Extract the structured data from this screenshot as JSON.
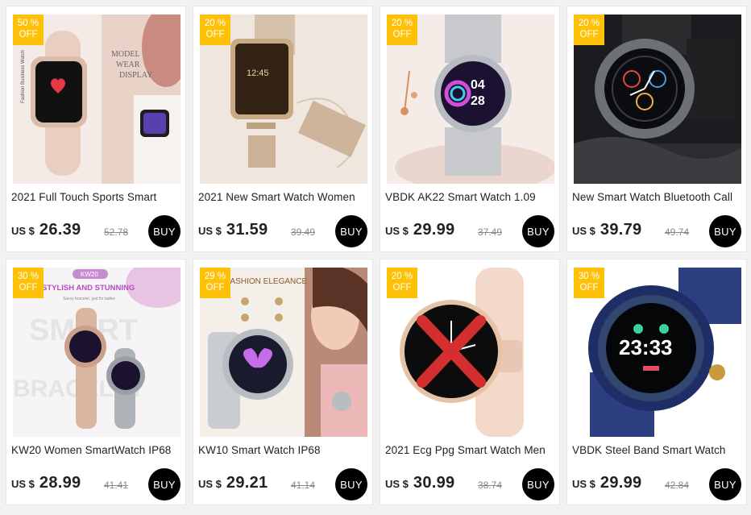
{
  "products": [
    {
      "badge_pct": "50 %",
      "badge_off": "OFF",
      "image_text_1": "MODEL",
      "image_text_2": "WEAR",
      "image_text_3": "DISPLAY",
      "image_text_4": "Fashion Business Watch",
      "title": "2021 Full Touch Sports Smart",
      "currency": "US $",
      "price": "26.39",
      "old_price": "52.78",
      "buy_label": "BUY"
    },
    {
      "badge_pct": "20 %",
      "badge_off": "OFF",
      "watch_time": "12:45",
      "title": "2021 New Smart Watch Women",
      "currency": "US $",
      "price": "31.59",
      "old_price": "39.49",
      "buy_label": "BUY"
    },
    {
      "badge_pct": "20 %",
      "badge_off": "OFF",
      "watch_time_h": "04",
      "watch_time_m": "28",
      "title": "VBDK AK22 Smart Watch 1.09",
      "currency": "US $",
      "price": "29.99",
      "old_price": "37.49",
      "buy_label": "BUY"
    },
    {
      "badge_pct": "20 %",
      "badge_off": "OFF",
      "title": "New Smart Watch Bluetooth Call",
      "currency": "US $",
      "price": "39.79",
      "old_price": "49.74",
      "buy_label": "BUY"
    },
    {
      "badge_pct": "30 %",
      "badge_off": "OFF",
      "image_tag": "KW20",
      "image_headline": "STYLISH AND STUNNING",
      "image_sub": "Savvy bracelet, just for ladies",
      "image_bg_word_1": "SMART",
      "image_bg_word_2": "BRACELET",
      "title": "KW20 Women SmartWatch IP68",
      "currency": "US $",
      "price": "28.99",
      "old_price": "41.41",
      "buy_label": "BUY"
    },
    {
      "badge_pct": "29 %",
      "badge_off": "OFF",
      "image_headline": "FASHION ELEGANCE",
      "title": "KW10 Smart Watch IP68",
      "currency": "US $",
      "price": "29.21",
      "old_price": "41.14",
      "buy_label": "BUY"
    },
    {
      "badge_pct": "20 %",
      "badge_off": "OFF",
      "title": "2021 Ecg Ppg Smart Watch Men",
      "currency": "US $",
      "price": "30.99",
      "old_price": "38.74",
      "buy_label": "BUY"
    },
    {
      "badge_pct": "30 %",
      "badge_off": "OFF",
      "watch_time": "23:33",
      "title": "VBDK Steel Band Smart Watch",
      "currency": "US $",
      "price": "29.99",
      "old_price": "42.84",
      "buy_label": "BUY"
    }
  ],
  "colors": {
    "badge": "#ffc107",
    "buy_button": "#000000",
    "page_bg": "#f2f2f2"
  }
}
